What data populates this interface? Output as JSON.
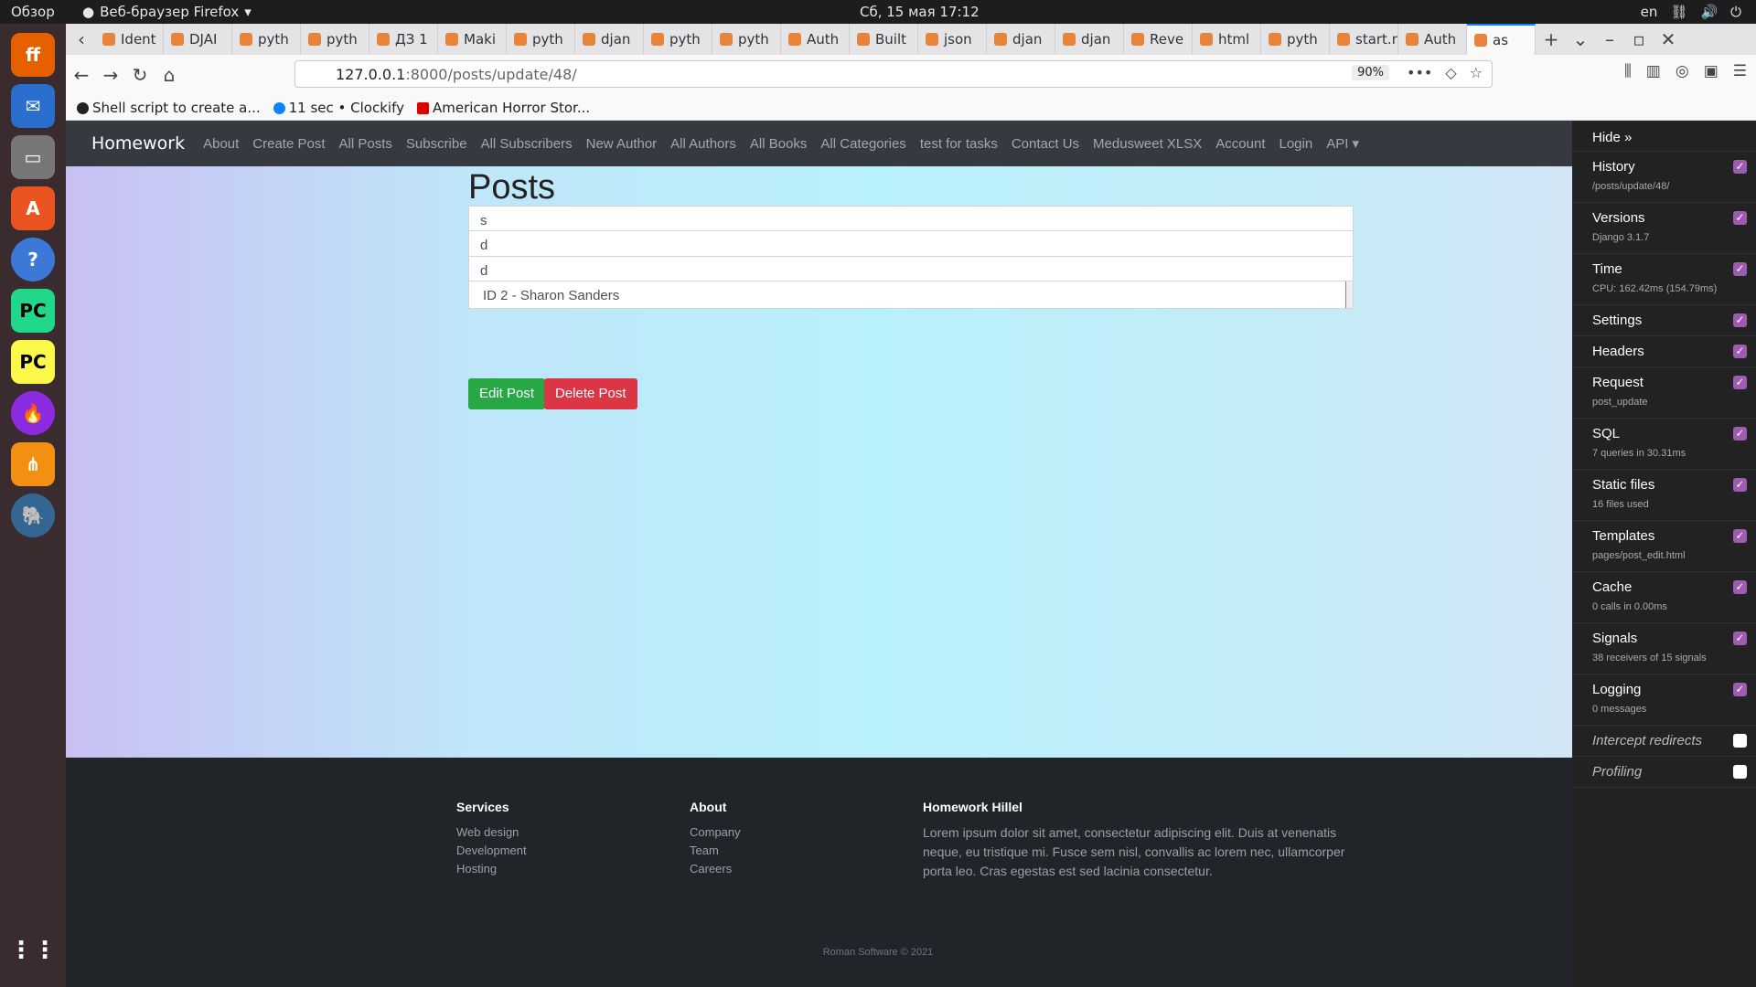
{
  "system": {
    "overview": "Обзор",
    "app_name": "Веб-браузер Firefox",
    "clock": "Сб, 15 мая  17:12",
    "lang": "en"
  },
  "tabs": [
    {
      "label": "Ident"
    },
    {
      "label": "DJAI"
    },
    {
      "label": "pyth"
    },
    {
      "label": "pyth"
    },
    {
      "label": "ДЗ 1"
    },
    {
      "label": "Maki"
    },
    {
      "label": "pyth"
    },
    {
      "label": "djan"
    },
    {
      "label": "pyth"
    },
    {
      "label": "pyth"
    },
    {
      "label": "Auth"
    },
    {
      "label": "Built"
    },
    {
      "label": "json"
    },
    {
      "label": "djan"
    },
    {
      "label": "djan"
    },
    {
      "label": "Reve"
    },
    {
      "label": "html"
    },
    {
      "label": "pyth"
    },
    {
      "label": "start.me"
    },
    {
      "label": "Auth"
    },
    {
      "label": "as"
    }
  ],
  "toolbar": {
    "url_host": "127.0.0.1",
    "url_rest": ":8000/posts/update/48/",
    "zoom": "90%"
  },
  "bookmarks": [
    {
      "label": "Shell script to create a..."
    },
    {
      "label": "11 sec • Clockify"
    },
    {
      "label": "American Horror Stor..."
    }
  ],
  "site": {
    "brand": "Homework",
    "nav": [
      "About",
      "Create Post",
      "All Posts",
      "Subscribe",
      "All Subscribers",
      "New Author",
      "All Authors",
      "All Books",
      "All Categories",
      "test for tasks",
      "Contact Us",
      "Medusweet XLSX",
      "Account",
      "Login",
      "API ▾"
    ],
    "heading": "Posts",
    "fields": [
      "s",
      "d",
      "d"
    ],
    "author_select": "ID 2 - Sharon Sanders",
    "edit_button": "Edit Post",
    "delete_button": "Delete Post"
  },
  "footer": {
    "services_title": "Services",
    "services": [
      "Web design",
      "Development",
      "Hosting"
    ],
    "about_title": "About",
    "about": [
      "Company",
      "Team",
      "Careers"
    ],
    "hw_title": "Homework Hillel",
    "hw_text": "Lorem ipsum dolor sit amet, consectetur adipiscing elit. Duis at venenatis neque, eu tristique mi. Fusce sem nisl, convallis ac lorem nec, ullamcorper porta leo. Cras egestas est sed lacinia consectetur.",
    "copyright": "Roman Software © 2021"
  },
  "debug_toolbar": {
    "hide": "Hide »",
    "panels": [
      {
        "title": "History",
        "sub": "/posts/update/48/",
        "checked": true
      },
      {
        "title": "Versions",
        "sub": "Django 3.1.7",
        "checked": true
      },
      {
        "title": "Time",
        "sub": "CPU: 162.42ms (154.79ms)",
        "checked": true
      },
      {
        "title": "Settings",
        "sub": "",
        "checked": true
      },
      {
        "title": "Headers",
        "sub": "",
        "checked": true
      },
      {
        "title": "Request",
        "sub": "post_update",
        "checked": true
      },
      {
        "title": "SQL",
        "sub": "7 queries in 30.31ms",
        "checked": true
      },
      {
        "title": "Static files",
        "sub": "16 files used",
        "checked": true
      },
      {
        "title": "Templates",
        "sub": "pages/post_edit.html",
        "checked": true
      },
      {
        "title": "Cache",
        "sub": "0 calls in 0.00ms",
        "checked": true
      },
      {
        "title": "Signals",
        "sub": "38 receivers of 15 signals",
        "checked": true
      },
      {
        "title": "Logging",
        "sub": "0 messages",
        "checked": true
      },
      {
        "title": "Intercept redirects",
        "sub": "",
        "checked": false
      },
      {
        "title": "Profiling",
        "sub": "",
        "checked": false
      }
    ]
  }
}
